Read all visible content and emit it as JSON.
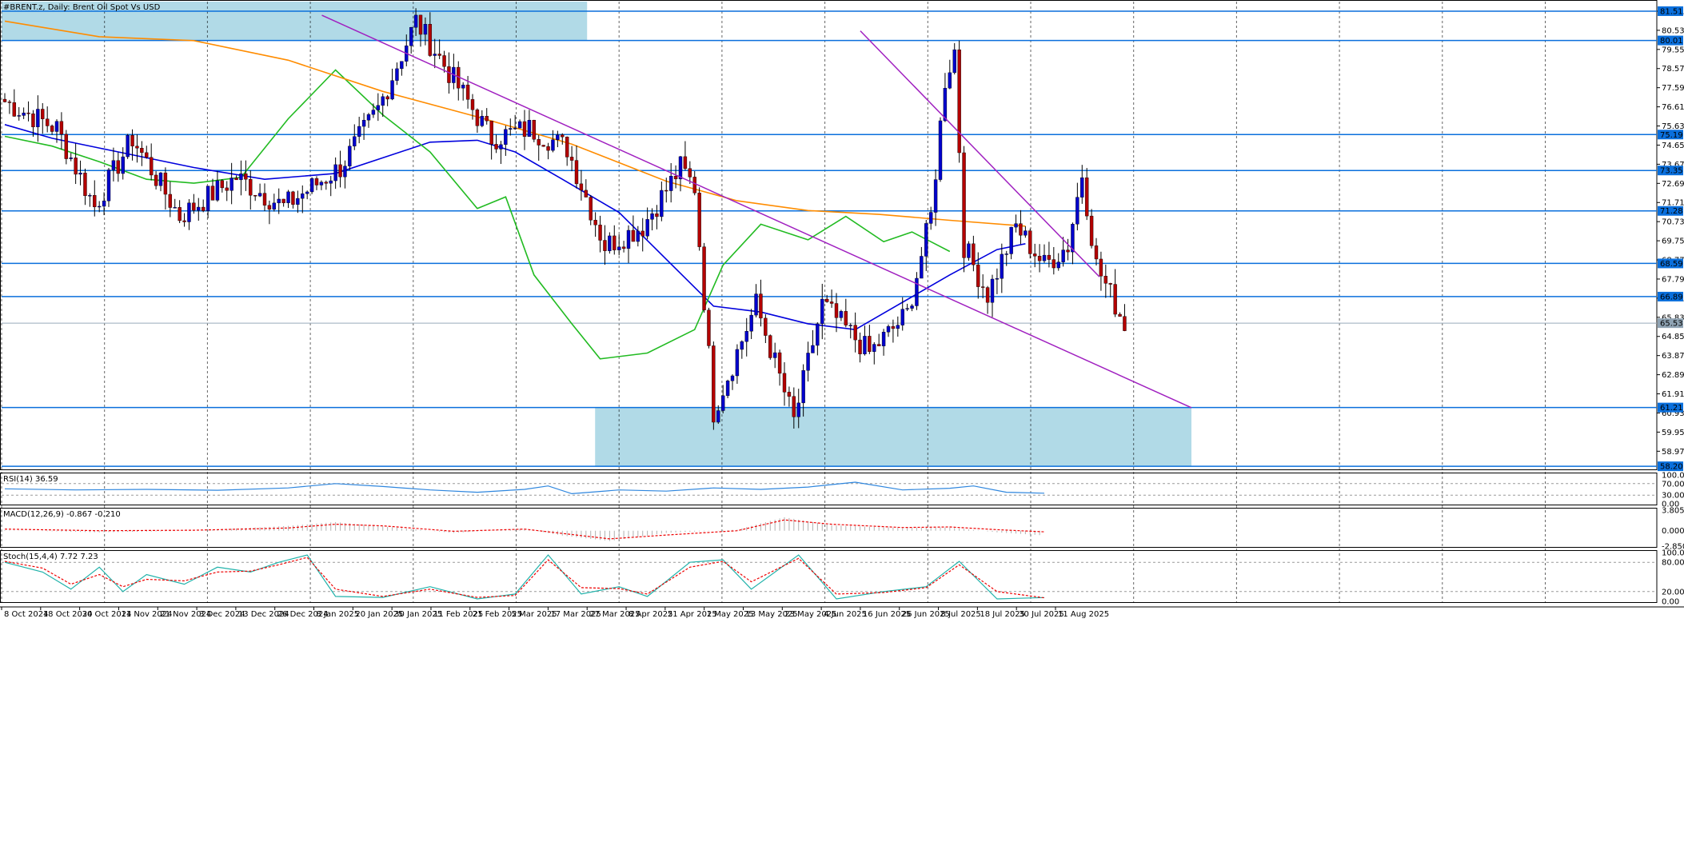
{
  "window": {
    "title": "#BRENT.z, Daily:  Brent Oil Spot Vs USD"
  },
  "colors": {
    "bull_candle": "#0000cc",
    "bear_candle": "#b30000",
    "sma_fast": "#22bb22",
    "sma_mid": "#0000dd",
    "sma_slow": "#ff8c00",
    "trendline": "#a020c0",
    "level_line": "#0a6fdc",
    "zone_fill": "#add8e6",
    "rsi_line": "#2e86de",
    "macd_hist": "#b0b0b0",
    "macd_signal": "#ee0000",
    "stoch_main": "#20b2aa",
    "stoch_signal": "#ee0000",
    "price_tag_bg": "#0a6fdc"
  },
  "chart_data": {
    "type": "candlestick",
    "symbol": "#BRENT.z",
    "timeframe": "Daily",
    "description": "Brent Oil Spot Vs USD",
    "ylim": [
      58.0,
      82.0
    ],
    "grid": "vertical dashed",
    "x_tick_labels": [
      "8 Oct 2024",
      "18 Oct 2024",
      "30 Oct 2024",
      "11 Nov 2024",
      "21 Nov 2024",
      "3 Dec 2024",
      "13 Dec 2024",
      "26 Dec 2024",
      "8 Jan 2025",
      "20 Jan 2025",
      "30 Jan 2025",
      "11 Feb 2025",
      "21 Feb 2025",
      "5 Mar 2025",
      "17 Mar 2025",
      "27 Mar 2025",
      "8 Apr 2025",
      "21 Apr 2025",
      "1 May 2025",
      "13 May 2025",
      "23 May 2025",
      "4 Jun 2025",
      "16 Jun 2025",
      "26 Jun 2025",
      "8 Jul 2025",
      "18 Jul 2025",
      "30 Jul 2025",
      "11 Aug 2025"
    ],
    "y_tick_labels": [
      "81.51",
      "80.53",
      "79.55",
      "78.57",
      "77.59",
      "76.61",
      "75.63",
      "74.65",
      "73.67",
      "72.69",
      "71.71",
      "70.73",
      "69.75",
      "68.77",
      "67.79",
      "66.81",
      "65.83",
      "64.85",
      "63.87",
      "62.89",
      "61.91",
      "60.93",
      "59.95",
      "58.97"
    ],
    "highlighted_levels": [
      "81.51",
      "80.01",
      "75.19",
      "73.35",
      "71.28",
      "68.59",
      "66.89",
      "61.21",
      "58.20"
    ],
    "current_price": "65.53",
    "zones": [
      {
        "from_date": "8 Oct 2024",
        "to_date": "27 Mar 2025",
        "low": 80.01,
        "high": 82.0
      },
      {
        "from_date": "29 Mar 2025",
        "to_date": "25 Aug 2025",
        "low": 58.2,
        "high": 61.21
      }
    ],
    "trendlines": [
      {
        "from": {
          "date": "10 Jan 2025",
          "price": 81.3
        },
        "to": {
          "date": "25 Aug 2025",
          "price": 61.2
        }
      },
      {
        "from": {
          "date": "16 Jun 2025",
          "price": 80.5
        },
        "to": {
          "date": "21 Aug 2025",
          "price": 67.9
        }
      }
    ],
    "candle_bar_count": 216,
    "candle_segments": [
      {
        "bars": 12,
        "to": 75.5
      },
      {
        "bars": 8,
        "to": 71.5
      },
      {
        "bars": 8,
        "to": 75.0
      },
      {
        "bars": 10,
        "to": 71.0
      },
      {
        "bars": 12,
        "to": 73.0
      },
      {
        "bars": 10,
        "to": 71.5
      },
      {
        "bars": 12,
        "to": 73.5
      },
      {
        "bars": 8,
        "to": 76.5
      },
      {
        "bars": 8,
        "to": 81.0
      },
      {
        "bars": 8,
        "to": 78.0
      },
      {
        "bars": 8,
        "to": 75.0
      },
      {
        "bars": 8,
        "to": 75.5
      },
      {
        "bars": 8,
        "to": 74.5
      },
      {
        "bars": 8,
        "to": 69.5
      },
      {
        "bars": 8,
        "to": 70.5
      },
      {
        "bars": 8,
        "to": 73.5
      },
      {
        "bars": 3,
        "to": 72.5
      },
      {
        "bars": 4,
        "to": 61.0
      },
      {
        "bars": 9,
        "to": 66.5
      },
      {
        "bars": 8,
        "to": 60.5
      },
      {
        "bars": 6,
        "to": 66.5
      },
      {
        "bars": 10,
        "to": 64.0
      },
      {
        "bars": 8,
        "to": 66.0
      },
      {
        "bars": 5,
        "to": 71.0
      },
      {
        "bars": 3,
        "to": 78.0
      },
      {
        "bars": 2,
        "to": 79.5
      },
      {
        "bars": 2,
        "to": 69.5
      },
      {
        "bars": 5,
        "to": 67.0
      },
      {
        "bars": 6,
        "to": 70.5
      },
      {
        "bars": 6,
        "to": 68.5
      },
      {
        "bars": 5,
        "to": 69.5
      },
      {
        "bars": 3,
        "to": 73.2
      },
      {
        "bars": 3,
        "to": 68.5
      },
      {
        "bars": 6,
        "to": 65.5
      }
    ],
    "overlays": [
      {
        "kind": "moving-average",
        "points": [
          [
            0,
            75.7
          ],
          [
            10,
            75.0
          ],
          [
            20,
            74.5
          ],
          [
            40,
            73.5
          ],
          [
            55,
            72.9
          ],
          [
            70,
            73.2
          ],
          [
            90,
            74.8
          ],
          [
            100,
            74.9
          ],
          [
            108,
            74.3
          ],
          [
            118,
            72.9
          ],
          [
            130,
            71.2
          ],
          [
            140,
            68.8
          ],
          [
            150,
            66.4
          ],
          [
            160,
            66.1
          ],
          [
            170,
            65.5
          ],
          [
            180,
            65.2
          ],
          [
            190,
            66.6
          ],
          [
            200,
            68.0
          ],
          [
            210,
            69.3
          ],
          [
            216,
            69.6
          ]
        ]
      },
      {
        "kind": "moving-average",
        "points": [
          [
            0,
            75.1
          ],
          [
            10,
            74.6
          ],
          [
            20,
            73.8
          ],
          [
            30,
            72.9
          ],
          [
            40,
            72.7
          ],
          [
            50,
            73.0
          ],
          [
            60,
            76.0
          ],
          [
            70,
            78.5
          ],
          [
            80,
            76.2
          ],
          [
            90,
            74.3
          ],
          [
            100,
            71.4
          ],
          [
            106,
            72.0
          ],
          [
            112,
            68.0
          ],
          [
            120,
            65.5
          ],
          [
            126,
            63.7
          ],
          [
            136,
            64.0
          ],
          [
            146,
            65.2
          ],
          [
            152,
            68.5
          ],
          [
            160,
            70.6
          ],
          [
            170,
            69.8
          ],
          [
            178,
            71.0
          ],
          [
            186,
            69.7
          ],
          [
            192,
            70.2
          ],
          [
            196,
            69.7
          ],
          [
            200,
            69.2
          ]
        ]
      },
      {
        "kind": "moving-average",
        "points": [
          [
            0,
            81.0
          ],
          [
            20,
            80.2
          ],
          [
            40,
            80.0
          ],
          [
            60,
            79.0
          ],
          [
            80,
            77.4
          ],
          [
            100,
            76.1
          ],
          [
            120,
            74.7
          ],
          [
            140,
            72.8
          ],
          [
            155,
            71.8
          ],
          [
            170,
            71.3
          ],
          [
            185,
            71.1
          ],
          [
            200,
            70.8
          ],
          [
            216,
            70.5
          ]
        ]
      }
    ],
    "indicators": [
      {
        "name": "RSI(14)",
        "values": [
          "36.59"
        ],
        "y_tick_labels": [
          "100.00",
          "70.00",
          "30.00",
          "0.00"
        ],
        "reference_levels": [
          70,
          30
        ],
        "points": [
          [
            0,
            52
          ],
          [
            15,
            48
          ],
          [
            30,
            50
          ],
          [
            45,
            47
          ],
          [
            60,
            55
          ],
          [
            70,
            70
          ],
          [
            80,
            60
          ],
          [
            90,
            48
          ],
          [
            100,
            40
          ],
          [
            110,
            50
          ],
          [
            115,
            62
          ],
          [
            120,
            35
          ],
          [
            130,
            48
          ],
          [
            140,
            44
          ],
          [
            150,
            55
          ],
          [
            160,
            50
          ],
          [
            170,
            58
          ],
          [
            180,
            75
          ],
          [
            190,
            48
          ],
          [
            200,
            54
          ],
          [
            205,
            62
          ],
          [
            212,
            40
          ],
          [
            220,
            36.59
          ]
        ]
      },
      {
        "name": "MACD(12,26,9)",
        "values": [
          "-0.867",
          "-0.210"
        ],
        "y_tick_labels": [
          "3.805",
          "0.000",
          "-2.850"
        ],
        "points": [
          [
            0,
            0.1
          ],
          [
            20,
            -0.3
          ],
          [
            40,
            0.0
          ],
          [
            60,
            0.9
          ],
          [
            70,
            1.6
          ],
          [
            80,
            0.8
          ],
          [
            95,
            -0.4
          ],
          [
            110,
            0.4
          ],
          [
            118,
            -0.9
          ],
          [
            128,
            -1.9
          ],
          [
            140,
            -0.4
          ],
          [
            155,
            0.2
          ],
          [
            165,
            2.5
          ],
          [
            175,
            1.0
          ],
          [
            190,
            0.5
          ],
          [
            200,
            0.6
          ],
          [
            210,
            -0.3
          ],
          [
            220,
            -0.867
          ]
        ],
        "signal_points": [
          [
            0,
            0.3
          ],
          [
            20,
            0.0
          ],
          [
            40,
            0.1
          ],
          [
            60,
            0.5
          ],
          [
            70,
            1.2
          ],
          [
            80,
            0.9
          ],
          [
            95,
            -0.1
          ],
          [
            110,
            0.3
          ],
          [
            118,
            -0.5
          ],
          [
            128,
            -1.5
          ],
          [
            140,
            -0.8
          ],
          [
            155,
            0.0
          ],
          [
            165,
            2.0
          ],
          [
            175,
            1.2
          ],
          [
            190,
            0.6
          ],
          [
            200,
            0.7
          ],
          [
            210,
            0.2
          ],
          [
            220,
            -0.21
          ]
        ]
      },
      {
        "name": "Stoch(15,4,4)",
        "values": [
          "7.72",
          "7.23"
        ],
        "y_tick_labels": [
          "100.00",
          "80.00",
          "20.00",
          "0.00"
        ],
        "reference_levels": [
          80,
          20
        ],
        "points": [
          [
            0,
            80
          ],
          [
            8,
            60
          ],
          [
            14,
            25
          ],
          [
            20,
            70
          ],
          [
            25,
            20
          ],
          [
            30,
            55
          ],
          [
            38,
            35
          ],
          [
            45,
            70
          ],
          [
            52,
            60
          ],
          [
            58,
            80
          ],
          [
            64,
            95
          ],
          [
            70,
            10
          ],
          [
            80,
            8
          ],
          [
            90,
            30
          ],
          [
            100,
            5
          ],
          [
            108,
            15
          ],
          [
            115,
            95
          ],
          [
            122,
            15
          ],
          [
            130,
            30
          ],
          [
            136,
            10
          ],
          [
            145,
            80
          ],
          [
            152,
            85
          ],
          [
            158,
            25
          ],
          [
            168,
            95
          ],
          [
            176,
            5
          ],
          [
            186,
            20
          ],
          [
            195,
            30
          ],
          [
            202,
            82
          ],
          [
            210,
            5
          ],
          [
            220,
            7.72
          ]
        ],
        "signal_points": [
          [
            0,
            82
          ],
          [
            8,
            68
          ],
          [
            14,
            35
          ],
          [
            20,
            55
          ],
          [
            25,
            30
          ],
          [
            30,
            45
          ],
          [
            38,
            42
          ],
          [
            45,
            60
          ],
          [
            52,
            62
          ],
          [
            58,
            75
          ],
          [
            64,
            90
          ],
          [
            70,
            25
          ],
          [
            80,
            10
          ],
          [
            90,
            25
          ],
          [
            100,
            8
          ],
          [
            108,
            12
          ],
          [
            115,
            85
          ],
          [
            122,
            28
          ],
          [
            130,
            26
          ],
          [
            136,
            15
          ],
          [
            145,
            70
          ],
          [
            152,
            82
          ],
          [
            158,
            40
          ],
          [
            168,
            88
          ],
          [
            176,
            15
          ],
          [
            186,
            18
          ],
          [
            195,
            28
          ],
          [
            202,
            75
          ],
          [
            210,
            20
          ],
          [
            220,
            7.23
          ]
        ]
      }
    ]
  }
}
